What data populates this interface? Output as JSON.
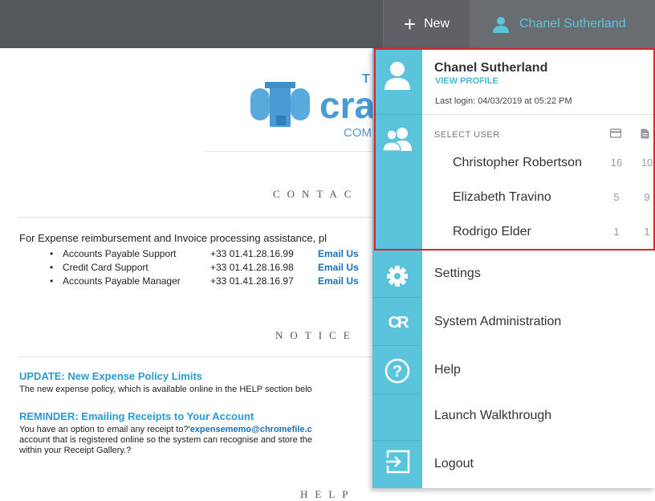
{
  "topbar": {
    "new_label": "New",
    "user_name": "Chanel Sutherland"
  },
  "logo": {
    "text_main": "cra",
    "text_sub": "COM",
    "text_top": "T"
  },
  "contact": {
    "title": "CONTAC",
    "intro": "For Expense reimbursement and Invoice processing assistance, pl",
    "rows": [
      {
        "name": "Accounts Payable Support",
        "phone": "+33 01.41.28.16.99",
        "email": "Email Us"
      },
      {
        "name": "Credit Card Support",
        "phone": "+33 01.41.28.16.98",
        "email": "Email Us"
      },
      {
        "name": "Accounts Payable Manager",
        "phone": "+33 01.41.28.16.97",
        "email": "Email Us"
      }
    ]
  },
  "notice": {
    "title": "NOTICE",
    "update_head": "UPDATE: New Expense Policy Limits",
    "update_text": "The new expense policy, which is available online in the HELP section belo",
    "reminder_head": "REMINDER: Emailing Receipts to Your Account",
    "reminder_line1_pre": "You have an option to email any receipt to?'",
    "reminder_line1_email": "expensememo@chromefile.c",
    "reminder_line2": "account that is registered online so the system can recognise and store the",
    "reminder_line3": "within your Receipt Gallery.?"
  },
  "help": {
    "title": "HELP"
  },
  "dropdown": {
    "profile_name": "Chanel Sutherland",
    "view_profile": "VIEW PROFILE",
    "last_login": "Last login: 04/03/2019 at 05:22 PM",
    "select_user": "SELECT USER",
    "users": [
      {
        "name": "Christopher Robertson",
        "c1": "16",
        "c2": "10"
      },
      {
        "name": "Elizabeth Travino",
        "c1": "5",
        "c2": "9"
      },
      {
        "name": "Rodrigo Elder",
        "c1": "1",
        "c2": "1"
      }
    ],
    "menu": {
      "settings": "Settings",
      "system_admin": "System Administration",
      "help": "Help",
      "walkthrough": "Launch Walkthrough",
      "logout": "Logout"
    },
    "rail_logo_text": "CR"
  },
  "colors": {
    "accent": "#5bc4dc",
    "topbar": "#54575c",
    "highlight": "#e4202a",
    "link": "#1a70b8"
  }
}
